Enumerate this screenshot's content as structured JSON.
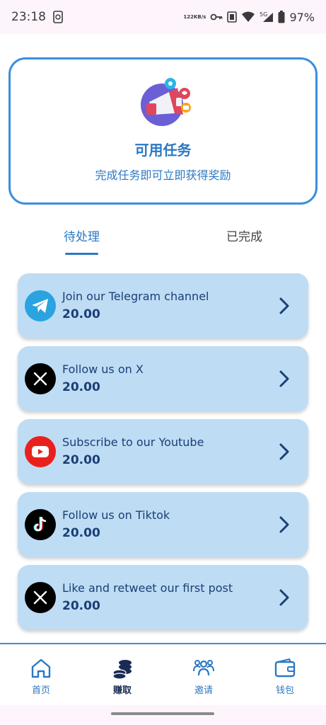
{
  "status_bar": {
    "time": "23:18",
    "net_speed_value": "122",
    "net_speed_unit": "KB/s",
    "network_type": "5G",
    "battery": "97%"
  },
  "header": {
    "title": "可用任务",
    "subtitle": "完成任务即可立即获得奖励",
    "icon": "megaphone-icon"
  },
  "tabs": [
    {
      "label": "待处理",
      "active": true
    },
    {
      "label": "已完成",
      "active": false
    }
  ],
  "tasks": [
    {
      "title": "Join our Telegram channel",
      "reward": "20.00",
      "icon": "telegram-icon"
    },
    {
      "title": "Follow us on X",
      "reward": "20.00",
      "icon": "x-icon"
    },
    {
      "title": "Subscribe to our Youtube",
      "reward": "20.00",
      "icon": "youtube-icon"
    },
    {
      "title": "Follow us on Tiktok",
      "reward": "20.00",
      "icon": "tiktok-icon"
    },
    {
      "title": "Like and retweet our first post",
      "reward": "20.00",
      "icon": "x-icon"
    }
  ],
  "bottom_nav": [
    {
      "label": "首页",
      "icon": "home-icon",
      "active": false
    },
    {
      "label": "赚取",
      "icon": "coins-icon",
      "active": true
    },
    {
      "label": "邀请",
      "icon": "users-icon",
      "active": false
    },
    {
      "label": "钱包",
      "icon": "wallet-icon",
      "active": false
    }
  ],
  "colors": {
    "accent": "#2b78c3",
    "card_border": "#3a8fdc",
    "task_bg": "#bfdcf5",
    "task_text": "#1a3f75",
    "nav_active": "#1a2a55"
  }
}
